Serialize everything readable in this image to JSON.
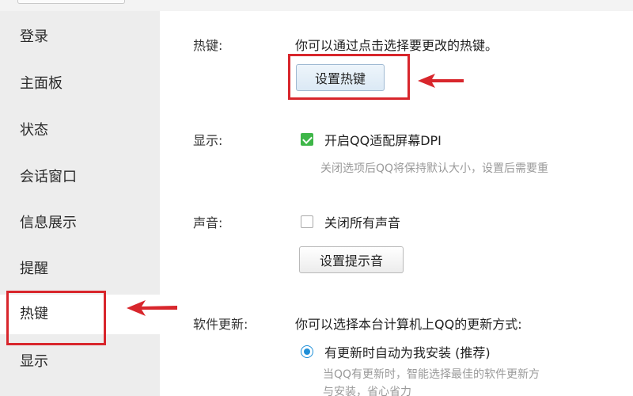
{
  "sidebar": {
    "items": [
      {
        "label": "登录"
      },
      {
        "label": "主面板"
      },
      {
        "label": "状态"
      },
      {
        "label": "会话窗口"
      },
      {
        "label": "信息展示"
      },
      {
        "label": "提醒"
      },
      {
        "label": "热键"
      },
      {
        "label": "显示"
      }
    ],
    "active_index": 6
  },
  "hotkey": {
    "label": "热键:",
    "description": "你可以通过点击选择要更改的热键。",
    "button_label": "设置热键"
  },
  "display": {
    "label": "显示:",
    "checkbox_label": "开启QQ适配屏幕DPI",
    "checked": true,
    "hint": "关闭选项后QQ将保持默认大小，设置后需要重"
  },
  "sound": {
    "label": "声音:",
    "checkbox_label": "关闭所有声音",
    "checked": false,
    "button_label": "设置提示音"
  },
  "update": {
    "label": "软件更新:",
    "description": "你可以选择本台计算机上QQ的更新方式:",
    "radio_label": "有更新时自动为我安装 (推荐)",
    "selected": true,
    "hint_line1": "当QQ有更新时，智能选择最佳的软件更新方",
    "hint_line2": "与安装，省心省力"
  },
  "colors": {
    "highlight": "#d8262c",
    "checkbox_checked": "#3eb648",
    "radio_selected": "#1e8fd8"
  }
}
